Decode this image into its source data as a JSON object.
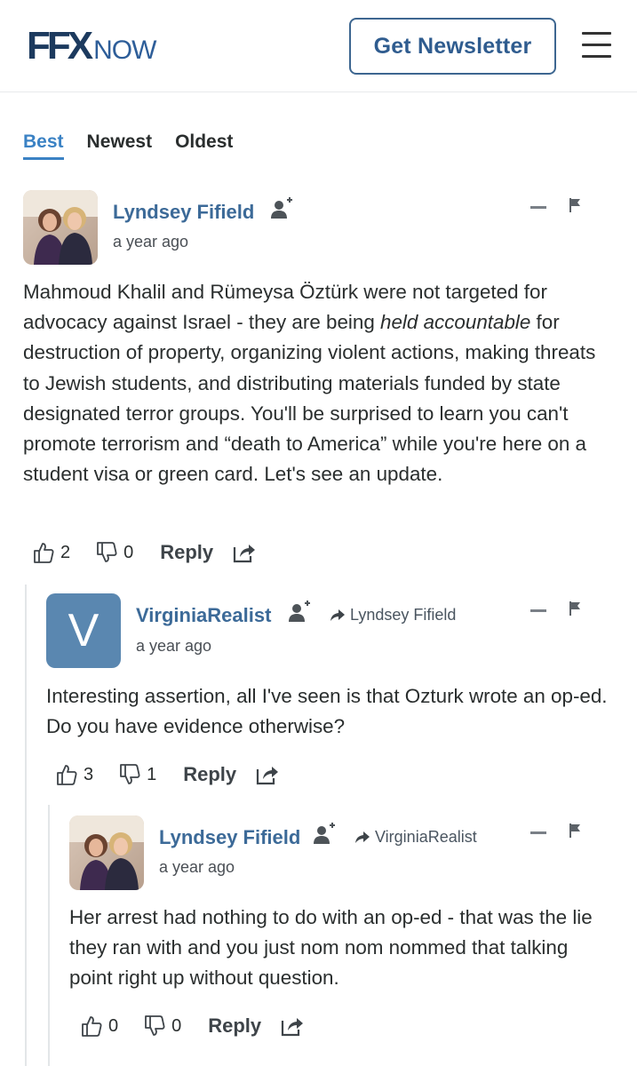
{
  "header": {
    "logo_ffx": "FFX",
    "logo_now": "NOW",
    "newsletter_label": "Get Newsletter",
    "menu_icon": "hamburger-menu-icon"
  },
  "tabs": [
    {
      "label": "Best",
      "active": true
    },
    {
      "label": "Newest",
      "active": false
    },
    {
      "label": "Oldest",
      "active": false
    }
  ],
  "comments": [
    {
      "author": "Lyndsey Fifield",
      "time": "a year ago",
      "reply_to": "",
      "avatar": "photo",
      "body_before": "Mahmoud Khalil and Rümeysa Öztürk were not targeted for advocacy against Israel - they are being ",
      "body_emph": "held accountable",
      "body_after": " for destruction of property, organizing violent actions, making threats to Jewish students, and distributing materials funded by state designated terror groups. You'll be surprised to learn you can't promote terrorism and “death to America” while you're here on a student visa or green card. Let's see an update.",
      "upvotes": "2",
      "downvotes": "0",
      "reply_label": "Reply"
    },
    {
      "author": "VirginiaRealist",
      "time": "a year ago",
      "reply_to": "Lyndsey Fifield",
      "avatar_letter": "V",
      "body": "Interesting assertion, all I've seen is that Ozturk wrote an op-ed. Do you have evidence otherwise?",
      "upvotes": "3",
      "downvotes": "1",
      "reply_label": "Reply"
    },
    {
      "author": "Lyndsey Fifield",
      "time": "a year ago",
      "reply_to": "VirginiaRealist",
      "avatar": "photo",
      "body": "Her arrest had nothing to do with an op-ed - that was the lie they ran with and you just nom nom nommed that talking point right up without question.",
      "upvotes": "0",
      "downvotes": "0",
      "reply_label": "Reply"
    }
  ],
  "colors": {
    "accent": "#3b82c4",
    "author": "#3c6a98",
    "avatar_v": "#5a87b0",
    "logo_dark": "#1c3a5e"
  }
}
